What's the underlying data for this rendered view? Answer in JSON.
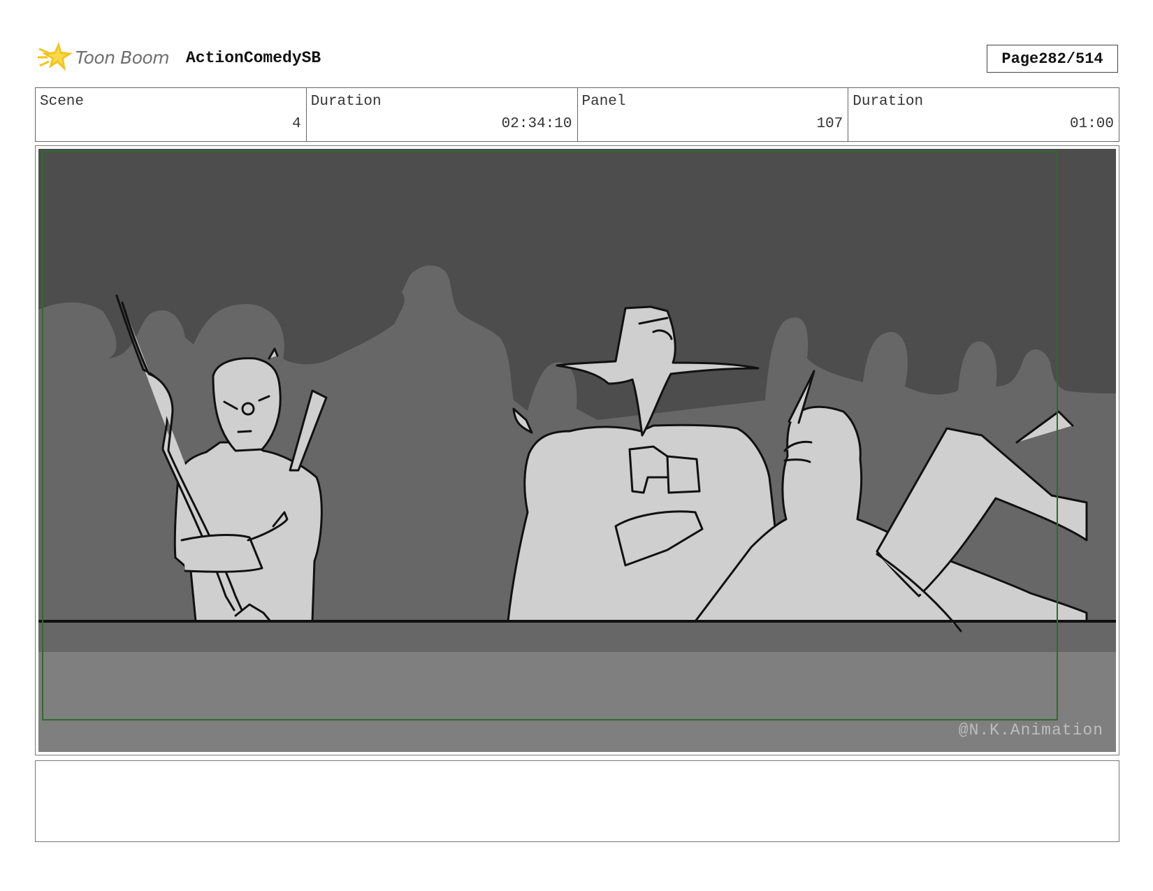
{
  "header": {
    "brand": "Toon Boom",
    "project_title": "ActionComedySB",
    "page_label": "Page",
    "page_current": "282",
    "page_total": "514"
  },
  "info": {
    "scene": {
      "label": "Scene",
      "value": "4"
    },
    "scene_duration": {
      "label": "Duration",
      "value": "02:34:10"
    },
    "panel": {
      "label": "Panel",
      "value": "107"
    },
    "panel_duration": {
      "label": "Duration",
      "value": "01:00"
    }
  },
  "panel": {
    "watermark": "@N.K.Animation",
    "colors": {
      "background": "#4d4d4d",
      "crowd": "#676767",
      "characters": "#cfcfcf",
      "floor": "#7f7f7f",
      "safe_frame": "#2e6b2e",
      "ink": "#111111"
    }
  },
  "notes": {
    "text": ""
  },
  "icons": {
    "logo": "toon-boom-logo-icon"
  }
}
